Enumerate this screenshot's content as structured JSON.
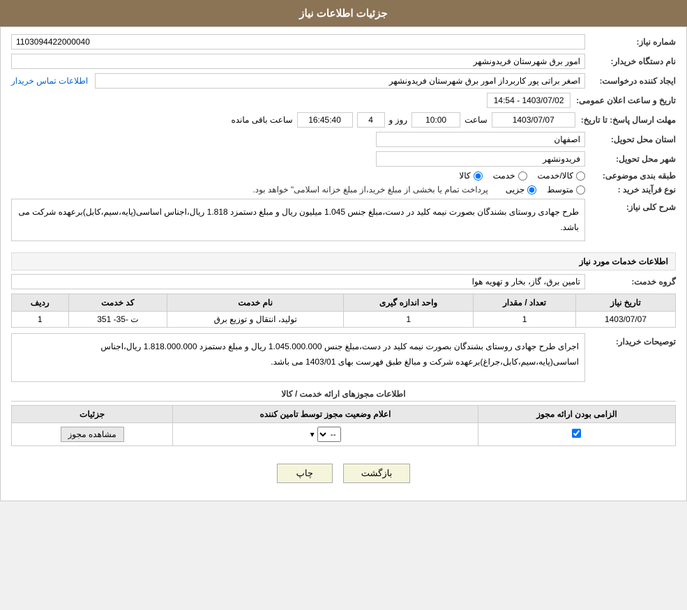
{
  "header": {
    "title": "جزئیات اطلاعات نیاز"
  },
  "fields": {
    "need_number_label": "شماره نیاز:",
    "need_number_value": "1103094422000040",
    "buyer_org_label": "نام دستگاه خریدار:",
    "buyer_org_value": "امور برق شهرستان فریدونشهر",
    "creator_label": "ایجاد کننده درخواست:",
    "creator_value": "اصغر براتی پور کاربرداز امور برق شهرستان فریدونشهر",
    "creator_link": "اطلاعات تماس خریدار",
    "announce_label": "تاریخ و ساعت اعلان عمومی:",
    "announce_value": "1403/07/02 - 14:54",
    "deadline_label": "مهلت ارسال پاسخ: تا تاریخ:",
    "deadline_date": "1403/07/07",
    "deadline_time_label": "ساعت",
    "deadline_time": "10:00",
    "deadline_days_label": "روز و",
    "deadline_days": "4",
    "deadline_remaining_label": "ساعت باقی مانده",
    "deadline_remaining": "16:45:40",
    "province_label": "استان محل تحویل:",
    "province_value": "اصفهان",
    "city_label": "شهر محل تحویل:",
    "city_value": "فریدونشهر",
    "category_label": "طبقه بندی موضوعی:",
    "category_radio_service": "خدمت",
    "category_radio_goods": "کالا",
    "category_radio_goods_service": "کالا/خدمت",
    "purchase_type_label": "نوع فرآیند خرید :",
    "purchase_type_partial": "جزیی",
    "purchase_type_medium": "متوسط",
    "purchase_type_note": "پرداخت تمام یا بخشی از مبلغ خرید،از مبلغ خزانه اسلامی\" خواهد بود.",
    "summary_label": "شرح کلی نیاز:",
    "summary_value": "طرح جهادی روستای بشندگان بصورت نیمه کلید در دست،مبلغ جنس 1.045 میلیون ریال و مبلغ دستمزد 1.818 ریال،اجناس اساسی(پایه،سیم،کابل)برعهده شرکت می باشد.",
    "service_info_label": "اطلاعات خدمات مورد نیاز",
    "service_group_label": "گروه خدمت:",
    "service_group_value": "تامین برق، گاز، بخار و تهویه هوا",
    "table": {
      "col_row": "ردیف",
      "col_code": "کد خدمت",
      "col_name": "نام خدمت",
      "col_unit": "واحد اندازه گیری",
      "col_qty": "تعداد / مقدار",
      "col_date": "تاریخ نیاز",
      "rows": [
        {
          "row": "1",
          "code": "ت -35- 351",
          "name": "تولید، انتقال و توزیع برق",
          "unit": "1",
          "qty": "1",
          "date": "1403/07/07"
        }
      ]
    },
    "buyer_desc_label": "توصیحات خریدار:",
    "buyer_desc_value": "اجرای طرح جهادی روستای بشندگان بصورت نیمه کلید در دست،مبلغ جنس 1.045.000.000 ریال و مبلغ دستمزد 1.818.000.000 ریال،اجناس اساسی(پایه،سیم،کابل،جراغ)برعهده شرکت و مبالغ طبق فهرست بهای 1403/01 می باشد.",
    "license_section_title": "اطلاعات مجوزهای ارائه خدمت / کالا",
    "license_table": {
      "col_required": "الزامی بودن ارائه مجوز",
      "col_announce": "اعلام وضعیت مجوز توسط تامین کننده",
      "col_details": "جزئیات",
      "rows": [
        {
          "required": true,
          "announce": "--",
          "details": "مشاهده مجوز"
        }
      ]
    },
    "btn_back": "بازگشت",
    "btn_print": "چاپ"
  }
}
